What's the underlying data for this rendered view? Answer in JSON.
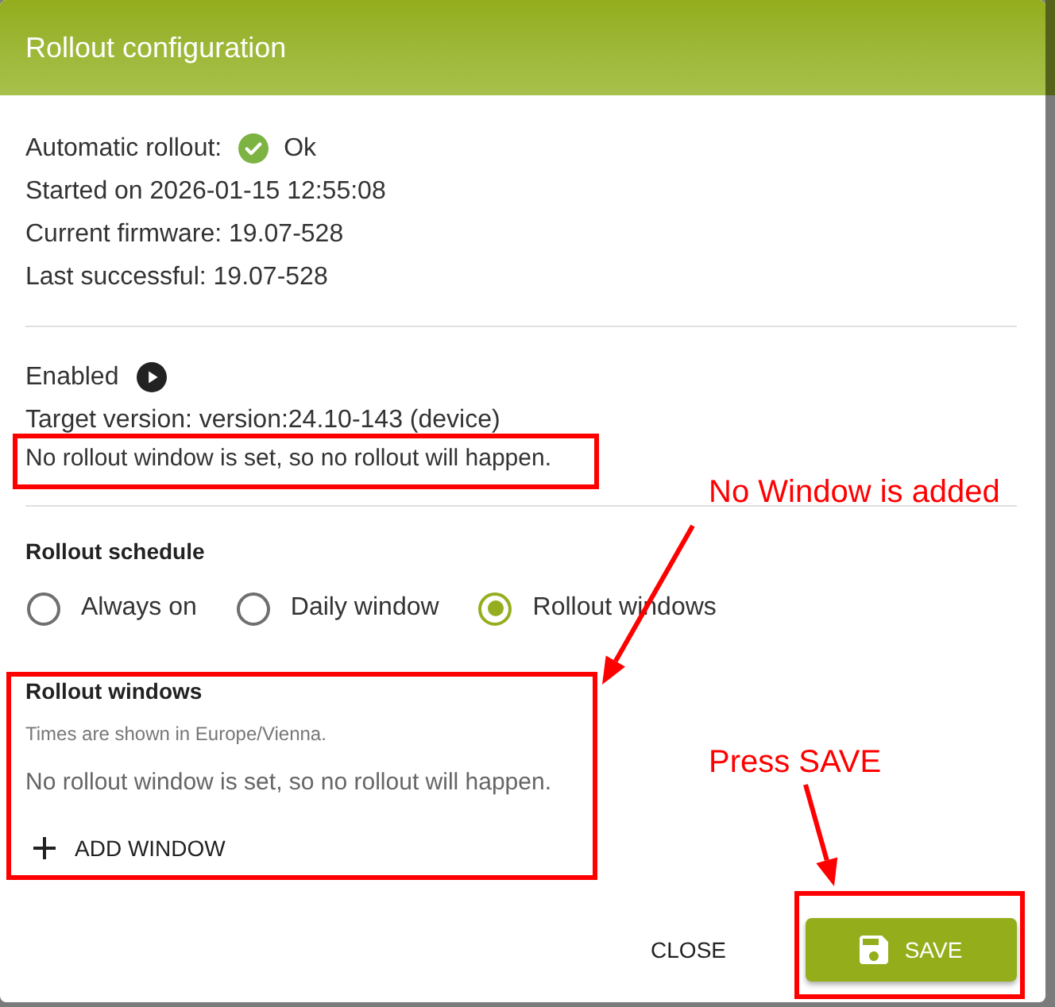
{
  "dialog": {
    "title": "Rollout configuration"
  },
  "status": {
    "automatic_rollout": {
      "label": "Automatic rollout:",
      "value": "Ok"
    },
    "lines": [
      "Started on 2026-01-15 12:55:08",
      "Current firmware: 19.07-528",
      "Last successful: 19.07-528"
    ]
  },
  "target": {
    "state_label": "Enabled",
    "target_version": "Target version: version:24.10-143 (device)",
    "message": "No rollout window is set, so no rollout will happen.",
    "message_highlighted": true
  },
  "schedule": {
    "label": "Rollout schedule",
    "options": [
      {
        "label": "Always on",
        "selected": false
      },
      {
        "label": "Daily window",
        "selected": false
      },
      {
        "label": "Rollout windows",
        "selected": true
      }
    ]
  },
  "rollout_windows": {
    "title": "Rollout windows",
    "timezone_note": "Times are shown in Europe/Vienna.",
    "empty_message": "No rollout window is set, so no rollout will happen.",
    "add_button": "ADD WINDOW",
    "highlighted": true
  },
  "buttons": [
    {
      "kind": "text",
      "label": "CLOSE"
    },
    {
      "kind": "primary",
      "label": "SAVE",
      "highlighted": true
    }
  ],
  "annotations": [
    {
      "text": "No Window is added"
    },
    {
      "text": "Press SAVE"
    }
  ]
}
